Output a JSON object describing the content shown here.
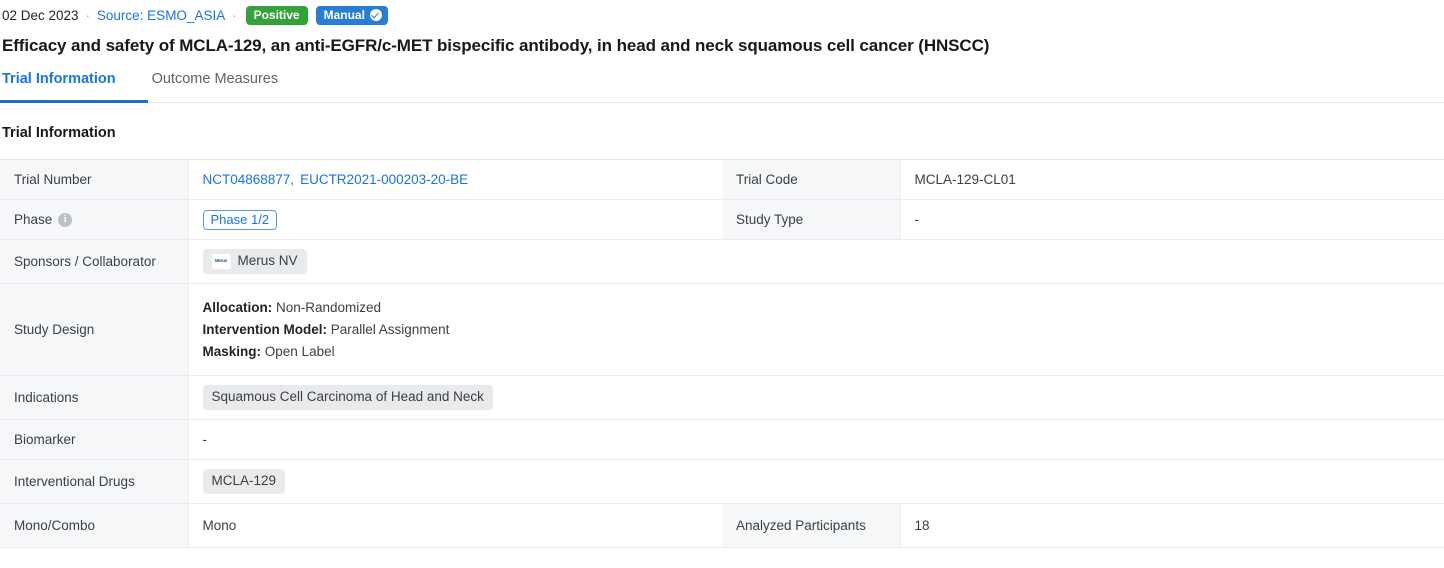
{
  "meta": {
    "date": "02 Dec 2023",
    "separator": "·",
    "source": "Source: ESMO_ASIA",
    "badge_positive": "Positive",
    "badge_manual": "Manual",
    "check_icon": "check-circle-icon"
  },
  "title": "Efficacy and safety of MCLA-129, an anti-EGFR/c-MET bispecific antibody, in head and neck squamous cell cancer (HNSCC)",
  "tabs": [
    {
      "label": "Trial Information",
      "active": true
    },
    {
      "label": "Outcome Measures",
      "active": false
    }
  ],
  "section": {
    "heading": "Trial Information"
  },
  "table": {
    "rows": {
      "trial_number": {
        "label": "Trial Number",
        "links": [
          "NCT04868877,",
          "EUCTR2021-000203-20-BE"
        ],
        "label2": "Trial Code",
        "value2": "MCLA-129-CL01"
      },
      "phase": {
        "label": "Phase",
        "info_icon": "info-icon",
        "pill": "Phase 1/2",
        "label2": "Study Type",
        "value2": "-"
      },
      "sponsors": {
        "label": "Sponsors / Collaborator",
        "chip": "Merus NV",
        "chip_logo": "Merus"
      },
      "study_design": {
        "label": "Study Design",
        "lines": [
          {
            "key": "Allocation:",
            "value": "Non-Randomized"
          },
          {
            "key": "Intervention Model:",
            "value": "Parallel Assignment"
          },
          {
            "key": "Masking:",
            "value": "Open Label"
          }
        ]
      },
      "indications": {
        "label": "Indications",
        "chip": "Squamous Cell Carcinoma of Head and Neck"
      },
      "biomarker": {
        "label": "Biomarker",
        "value": "-"
      },
      "drugs": {
        "label": "Interventional Drugs",
        "chip": "MCLA-129"
      },
      "mono_combo": {
        "label": "Mono/Combo",
        "value": "Mono",
        "label2": "Analyzed Participants",
        "value2": "18"
      }
    }
  },
  "colors": {
    "accent": "#1a73e8",
    "positive": "#34a13a",
    "manual": "#2b7cd3",
    "label_bg": "#f6f7f8",
    "chip_bg": "#e9eaec"
  }
}
